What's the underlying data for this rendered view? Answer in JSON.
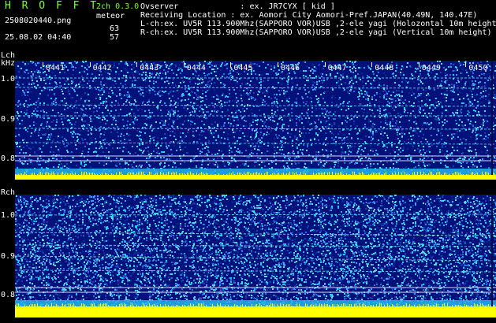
{
  "header": {
    "logo": "H R O F F T",
    "version": "2ch 0.3.0",
    "mode": "meteor",
    "file_name": "2508020440.png",
    "timestamp": "25.08.02 04:40",
    "count_l": "63",
    "count_r": "57",
    "observer_line": "Ovserver             : ex. JR7CYX [ kid ]",
    "location_line": "Receiving Location : ex. Aomori City Aomori-Pref.JAPAN(40.49N, 140.47E)",
    "lch_line": "L-ch:ex. UV5R 113.900Mhz(SAPPORO VOR)USB ,2-ele yagi (Holozontal 10m height)",
    "rch_line": "R-ch:ex. UV5R 113.900Mhz(SAPPORO VOR)USB ,2-ele yagi (Vertical 10m height)"
  },
  "lch": {
    "label": "Lch",
    "unit": "kHz",
    "ticks": [
      "1.0",
      "0.9",
      "0.8"
    ]
  },
  "rch": {
    "label": "Rch",
    "ticks": [
      "1.0",
      "0.9",
      "0.8"
    ]
  },
  "minutes": [
    "0441",
    "0442",
    "0443",
    "0444",
    "0445",
    "0446",
    "0447",
    "0448",
    "0449",
    "0450"
  ],
  "colors": {
    "background": "#000000",
    "spectrogram_base": "#00117a",
    "noise_cyan": "#33ccff",
    "baseline_yellow": "#ffff00",
    "header_green": "#7CFF3A"
  }
}
